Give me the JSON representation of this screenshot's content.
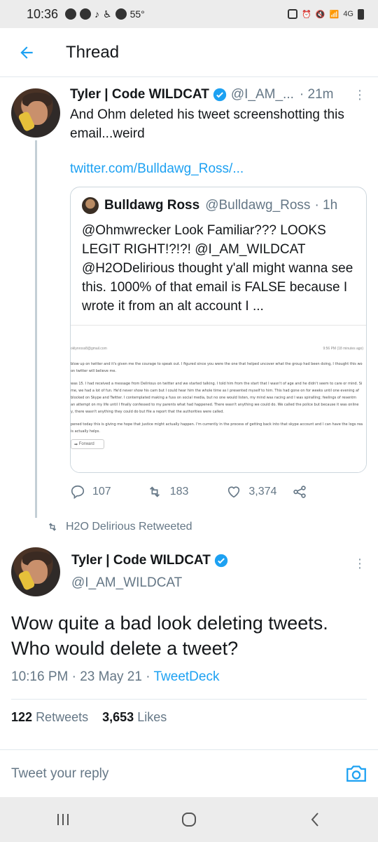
{
  "status_bar": {
    "time": "10:36",
    "temperature": "55°",
    "network": "4G"
  },
  "header": {
    "title": "Thread"
  },
  "tweet1": {
    "name": "Tyler | Code WILDCAT",
    "handle": "@I_AM_...",
    "time": "· 21m",
    "text": "And Ohm deleted his tweet screenshotting this email...weird",
    "link": "twitter.com/Bulldawg_Ross/...",
    "quote": {
      "name": "Bulldawg Ross",
      "handle": "@Bulldawg_Ross",
      "time": "· 1h",
      "text": "@Ohmwrecker Look Familiar???  LOOKS LEGIT RIGHT!?!?!  @I_AM_WILDCAT @H2ODelirious thought y'all might wanna see this. 1000% of that email is FALSE because I wrote it from an alt account I ...",
      "image": {
        "email": "oklynross8@gmail.com",
        "date": "9:56 PM (18 minutes ago)",
        "lines": [
          "blow up on twitter and it's given me the courage to speak out.  I figured since you were the one that helped uncover what the group had been doing, I thought this wo",
          "on twitter will believe me.",
          "was 15. I had received a message from Delirious on twitter and we started talking.  I told him from the start that I wasn't of age and he didn't seem to care or mind.  Si",
          "me, we had a lot of fun.  He'd never show his cam but I could hear him the whole time as I presented myself to him.  This had gone on for weeks until one evening af",
          "blocked on Skype and Twitter.  I contemplated making a fuss on social media, but no one would listen, my mind was racing and I was spiralling; feelings of resentm",
          "an attempt on my life until I finally confessed to my parents what had happened.  There wasn't anything we could do.  We called the police but because it was online",
          "y, there wasn't anything they could do but file a  report that the authorities were called.",
          "pened today this is giving me hope that justice might actually happen.  I'm currently in the process of getting back into that skype account and I can have the logs rea",
          "is actually helps."
        ],
        "forward_label": "Forward"
      }
    },
    "replies": "107",
    "retweets": "183",
    "likes": "3,374"
  },
  "retweeted_by": "H2O Delirious Retweeted",
  "tweet2": {
    "name": "Tyler | Code WILDCAT",
    "handle": "@I_AM_WILDCAT",
    "text": "Wow quite a bad look deleting tweets. Who would delete a tweet?",
    "timestamp": "10:16 PM · 23 May 21 · ",
    "source": "TweetDeck",
    "retweet_count": "122",
    "retweet_label": "Retweets",
    "like_count": "3,653",
    "like_label": "Likes"
  },
  "reply": {
    "placeholder": "Tweet your reply"
  },
  "colors": {
    "accent": "#1da1f2",
    "muted": "#657786",
    "text": "#14171a"
  },
  "icons": [
    "back-arrow-icon",
    "verified-badge-icon",
    "more-options-icon",
    "reply-icon",
    "retweet-icon",
    "like-icon",
    "share-icon",
    "camera-icon",
    "recents-icon",
    "home-icon",
    "back-icon"
  ]
}
